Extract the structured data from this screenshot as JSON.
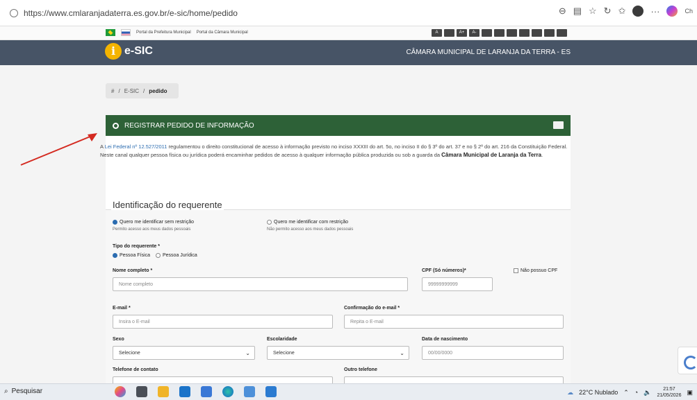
{
  "browser": {
    "url": "https://www.cmlaranjadaterra.es.gov.br/e-sic/home/pedido",
    "profile_label": "Ch"
  },
  "gov_bar": {
    "link1": "Portal da Prefeitura Municipal",
    "link2": "Portal da Câmara Municipal",
    "accessibility_buttons": [
      "A",
      "",
      "A+",
      "A-",
      "",
      "",
      "",
      "",
      "",
      "",
      ""
    ]
  },
  "header": {
    "logo_letter": "i",
    "logo_text": "e-SIC",
    "org_name": "CÂMARA MUNICIPAL DE LARANJA DA TERRA - ES"
  },
  "breadcrumb": {
    "home_icon": "#",
    "item1": "E-SIC",
    "current": "pedido"
  },
  "panel": {
    "title": "REGISTRAR PEDIDO DE INFORMAÇÃO",
    "intro_prefix": "A ",
    "intro_link": "Lei Federal nº 12.527/2011",
    "intro_rest": " regulamentou o direito constitucional de acesso à informação previsto no inciso XXXIII do art. 5o, no inciso II do § 3º do art. 37 e no § 2º do art. 216 da Constituição Federal.",
    "intro_line2": "Neste canal qualquer pessoa física ou jurídica poderá encaminhar pedidos de acesso à qualquer informação pública produzida ou sob a guarda da ",
    "intro_org": "Câmara Municipal de Laranja da Terra",
    "intro_end": "."
  },
  "form": {
    "section_title": "Identificação do requerente",
    "identify_open": "Quero me identificar sem restrição",
    "identify_open_sub": "Permito acesso aos meus dados pessoais",
    "identify_restricted": "Quero me identificar com restrição",
    "identify_restricted_sub": "Não permito acesso aos meus dados pessoais",
    "tipo_label": "Tipo do requerente *",
    "tipo_pf": "Pessoa Física",
    "tipo_pj": "Pessoa Jurídica",
    "nome_label": "Nome completo *",
    "nome_placeholder": "Nome completo",
    "cpf_label": "CPF (Só números)*",
    "cpf_placeholder": "99999999999",
    "no_cpf_label": "Não possuo CPF",
    "email_label": "E-mail *",
    "email_placeholder": "Insira o E-mail",
    "email_confirm_label": "Confirmação do e-mail *",
    "email_confirm_placeholder": "Repita o E-mail",
    "sexo_label": "Sexo",
    "sexo_value": "Selecione",
    "escolaridade_label": "Escolaridade",
    "escolaridade_value": "Selecione",
    "nascimento_label": "Data de nascimento",
    "nascimento_placeholder": "00/00/0000",
    "telefone_label": "Telefone de contato",
    "outro_tel_label": "Outro telefone"
  },
  "taskbar": {
    "search": "Pesquisar",
    "weather": "22°C  Nublado",
    "time": "21:57",
    "date": "21/05/2026"
  },
  "colors": {
    "header": "#475466",
    "panel_head": "#2d6137",
    "arrow": "#d42a20"
  }
}
